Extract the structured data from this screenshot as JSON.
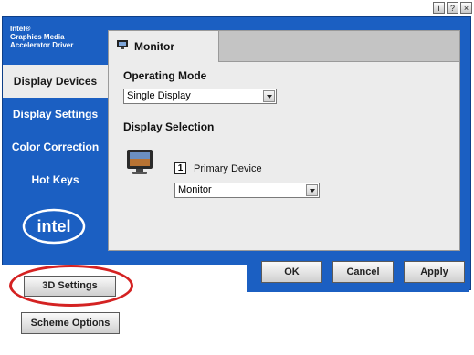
{
  "window_controls": {
    "help_glyph": "i",
    "question_glyph": "?",
    "close_glyph": "×"
  },
  "brand": {
    "line1": "Intel®",
    "line2": "Graphics Media",
    "line3": "Accelerator Driver"
  },
  "sidebar": {
    "items": [
      {
        "label": "Display Devices"
      },
      {
        "label": "Display Settings"
      },
      {
        "label": "Color Correction"
      },
      {
        "label": "Hot Keys"
      }
    ],
    "active_index": 0
  },
  "logo": {
    "text": "intel"
  },
  "tab": {
    "label": "Monitor"
  },
  "operating_mode": {
    "heading": "Operating Mode",
    "value": "Single Display"
  },
  "display_selection": {
    "heading": "Display Selection",
    "number": "1",
    "device_label": "Primary Device",
    "device_value": "Monitor"
  },
  "buttons": {
    "ok": "OK",
    "cancel": "Cancel",
    "apply": "Apply",
    "three_d_settings": "3D Settings",
    "scheme_options": "Scheme Options"
  },
  "colors": {
    "panel_blue": "#1b5fc2",
    "highlight_ring": "#d42222"
  }
}
